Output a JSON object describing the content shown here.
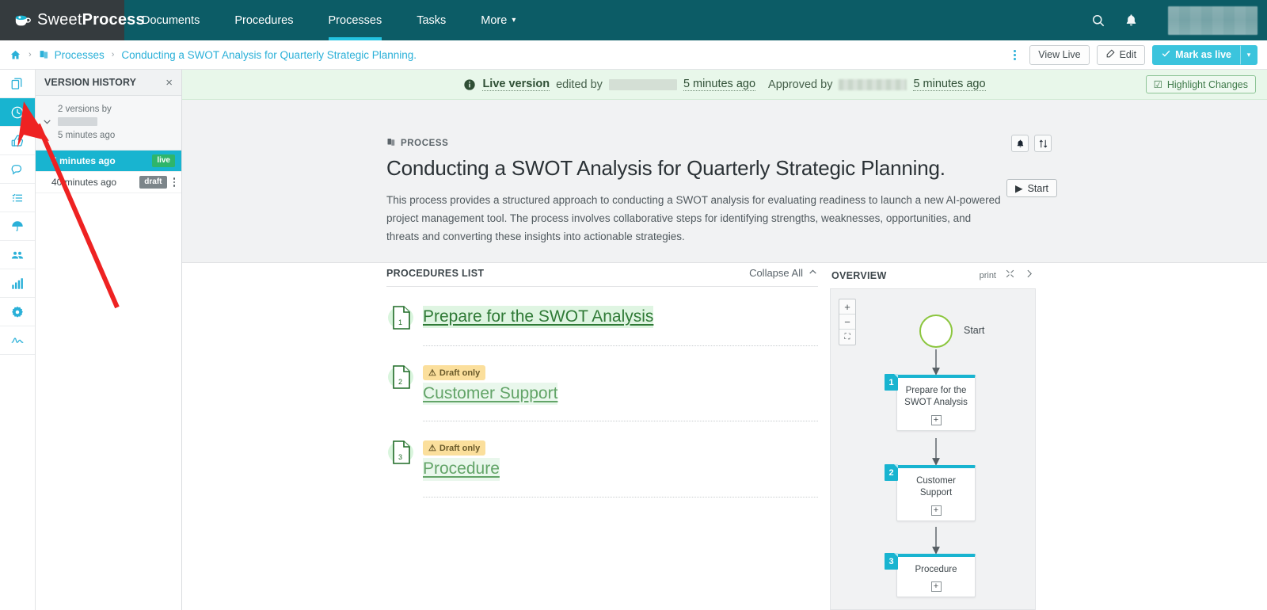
{
  "topnav": {
    "brand_light": "Sweet",
    "brand_bold": "Process",
    "items": [
      {
        "label": "Documents",
        "active": false
      },
      {
        "label": "Procedures",
        "active": false
      },
      {
        "label": "Processes",
        "active": true
      },
      {
        "label": "Tasks",
        "active": false
      },
      {
        "label": "More",
        "active": false,
        "caret": "▾"
      }
    ],
    "search_icon": "search-icon",
    "bell_icon": "bell-icon"
  },
  "breadcrumb": {
    "home": "⌂",
    "sep": "›",
    "processes": "Processes",
    "current": "Conducting a SWOT Analysis for Quarterly Strategic Planning.",
    "view_live": "View Live",
    "edit": "Edit",
    "mark_as_live": "Mark as live",
    "split_caret": "▾"
  },
  "rail": {
    "items": [
      {
        "name": "documents-icon",
        "active": false
      },
      {
        "name": "history-clock-icon",
        "active": true
      },
      {
        "name": "thumbs-up-icon",
        "active": false
      },
      {
        "name": "comments-icon",
        "active": false
      },
      {
        "name": "tasks-list-icon",
        "active": false
      },
      {
        "name": "umbrella-icon",
        "active": false
      },
      {
        "name": "teams-icon",
        "active": false
      },
      {
        "name": "analytics-icon",
        "active": false
      },
      {
        "name": "settings-gear-icon",
        "active": false
      },
      {
        "name": "signature-icon",
        "active": false
      }
    ]
  },
  "version_history": {
    "title": "VERSION HISTORY",
    "close": "×",
    "group": {
      "line1": "2 versions by",
      "line2_redacted": true,
      "line3": "5 minutes ago",
      "chevron": "⌄"
    },
    "rows": [
      {
        "time": "5 minutes ago",
        "badge": "live",
        "badge_type": "live",
        "selected": true
      },
      {
        "time": "40 minutes ago",
        "badge": "draft",
        "badge_type": "draft",
        "selected": false
      }
    ]
  },
  "live_banner": {
    "info_icon": "info-icon",
    "live_version": "Live version",
    "edited_by": "edited by",
    "edited_time": "5 minutes ago",
    "approved_by": "Approved by",
    "approved_time": "5 minutes ago",
    "highlight_changes": "Highlight Changes",
    "highlight_check": "☑"
  },
  "process_header": {
    "kicker": "PROCESS",
    "title": "Conducting a SWOT Analysis for Quarterly Strategic Planning.",
    "description": "This process provides a structured approach to conducting a SWOT analysis for evaluating readiness to launch a new AI-powered project management tool. The process involves collaborative steps for identifying strengths, weaknesses, opportunities, and threats and converting these insights into actionable strategies.",
    "start_button": "Start",
    "start_glyph": "▶",
    "bell_icon": "bell-icon",
    "reorder_icon": "reorder-icon"
  },
  "procedures_list": {
    "title": "PROCEDURES LIST",
    "collapse_all": "Collapse All",
    "collapse_caret": "⌃",
    "items": [
      {
        "number": "1",
        "label": "Prepare for the SWOT Analysis",
        "draft": null,
        "muted": false
      },
      {
        "number": "2",
        "label": "Customer Support",
        "draft": "Draft only",
        "muted": true
      },
      {
        "number": "3",
        "label": "Procedure",
        "draft": "Draft only",
        "muted": true
      }
    ],
    "draft_warning_glyph": "⚠"
  },
  "overview": {
    "title": "OVERVIEW",
    "print": "print",
    "fullscreen_icon": "fullscreen-icon",
    "expand_icon": "chevron-right-icon",
    "zoom_in": "+",
    "zoom_out": "−",
    "zoom_fit": "⛶",
    "start_label": "Start",
    "nodes": [
      {
        "number": "1",
        "label": "Prepare for the\nSWOT Analysis",
        "plus": "+"
      },
      {
        "number": "2",
        "label": "Customer\nSupport",
        "plus": "+"
      },
      {
        "number": "3",
        "label": "Procedure",
        "plus": "+"
      }
    ]
  },
  "colors": {
    "nav_bg": "#0c5c66",
    "brand_bg": "#353b3e",
    "accent_cyan": "#18b4d0",
    "link_cyan": "#2ab0d8",
    "live_green": "#2eb56b",
    "banner_green_bg": "#e8f7ea",
    "highlight_green": "#dff5e2",
    "draft_amber": "#fbdf9c",
    "annotation_red": "#ee2222"
  }
}
